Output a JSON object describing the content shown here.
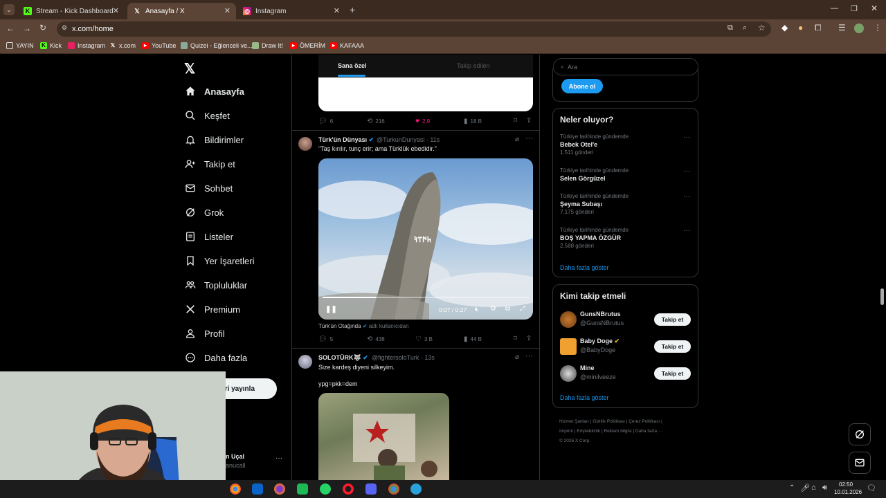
{
  "browser": {
    "tabs": [
      {
        "title": "Stream - Kick Dashboard",
        "icon": "kick-icon"
      },
      {
        "title": "Anasayfa / X",
        "icon": "x-icon"
      },
      {
        "title": "Instagram",
        "icon": "instagram-icon"
      }
    ],
    "url": "x.com/home",
    "bookmarks": [
      "YAYIN",
      "Kick",
      "Instagram",
      "x.com",
      "YouTube",
      "Quizei - Eğlenceli ve...",
      "Draw It!",
      "ÖMERİM",
      "KAFAAA"
    ]
  },
  "sidebar": {
    "items": [
      {
        "label": "Anasayfa",
        "icon": "home-icon"
      },
      {
        "label": "Keşfet",
        "icon": "search-icon"
      },
      {
        "label": "Bildirimler",
        "icon": "bell-icon"
      },
      {
        "label": "Takip et",
        "icon": "person-add-icon"
      },
      {
        "label": "Sohbet",
        "icon": "mail-icon"
      },
      {
        "label": "Grok",
        "icon": "grok-icon"
      },
      {
        "label": "Listeler",
        "icon": "list-icon"
      },
      {
        "label": "Yer İşaretleri",
        "icon": "bookmark-icon"
      },
      {
        "label": "Topluluklar",
        "icon": "people-icon"
      },
      {
        "label": "Premium",
        "icon": "x-icon"
      },
      {
        "label": "Profil",
        "icon": "person-icon"
      },
      {
        "label": "Daha fazla",
        "icon": "more-circle-icon"
      }
    ],
    "post_button_partial": "ri yayınla",
    "account_name_partial": "n Uçal",
    "account_handle_partial": "anucall"
  },
  "feed": {
    "tabs": [
      "Sana özel",
      "Takip edilen"
    ],
    "post0_stats": {
      "replies": "6",
      "reposts": "216",
      "likes": "2,9",
      "views": "18 B"
    },
    "post1": {
      "author": "Türk'ün Dünyası",
      "handle": "@TurkunDunyasi",
      "time": "11s",
      "text": "\"Taş kırılır, tunç erir; ama Türklük ebedidir.\"",
      "video_overlay_text": "𐱅𐰇𐰼𐰚",
      "video_time": "0:07 / 0:27",
      "attribution": "Türk'ün Otağında",
      "attribution_suffix": "adlı kullanıcıdan",
      "stats": {
        "replies": "5",
        "reposts": "438",
        "likes": "3 B",
        "views": "44 B"
      }
    },
    "post2": {
      "author": "SOLOTÜRK🐺",
      "handle": "@fightersoloTurk",
      "time": "13s",
      "text": "Size kardeş diyeni silkeyim.",
      "text2": "ypg=pkk=dem"
    }
  },
  "right": {
    "search_placeholder": "Ara",
    "subscribe_button": "Abone ol",
    "trends_title": "Neler oluyor?",
    "trends": [
      {
        "context": "Türkiye tarihinde gündemde",
        "name": "Bebek Otel'e",
        "count": "1.511 gönderi"
      },
      {
        "context": "Türkiye tarihinde gündemde",
        "name": "Selen Görgüzel",
        "count": ""
      },
      {
        "context": "Türkiye tarihinde gündemde",
        "name": "Şeyma Subaşı",
        "count": "7.175 gönderi"
      },
      {
        "context": "Türkiye tarihinde gündemde",
        "name": "BOŞ YAPMA ÖZGÜR",
        "count": "2.588 gönderi"
      }
    ],
    "trends_more": "Daha fazla göster",
    "who_title": "Kimi takip etmeli",
    "who": [
      {
        "name": "GunsNBrutus",
        "handle": "@GunsNBrutus",
        "button": "Takip et"
      },
      {
        "name": "Baby Doge",
        "handle": "@BabyDoge",
        "button": "Takip et"
      },
      {
        "name": "Mine",
        "handle": "@minilveeze",
        "button": "Takip et"
      }
    ],
    "who_more": "Daha fazla göster",
    "footer": [
      "Hizmet Şartları",
      "Gizlilik Politikası",
      "Çerez Politikası",
      "Imprint",
      "Erişilebilirlik",
      "Reklam bilgisi",
      "Daha fazla ···",
      "© 2026 X Corp."
    ]
  },
  "taskbar": {
    "time": "02:50",
    "date": "10.01.2026"
  }
}
